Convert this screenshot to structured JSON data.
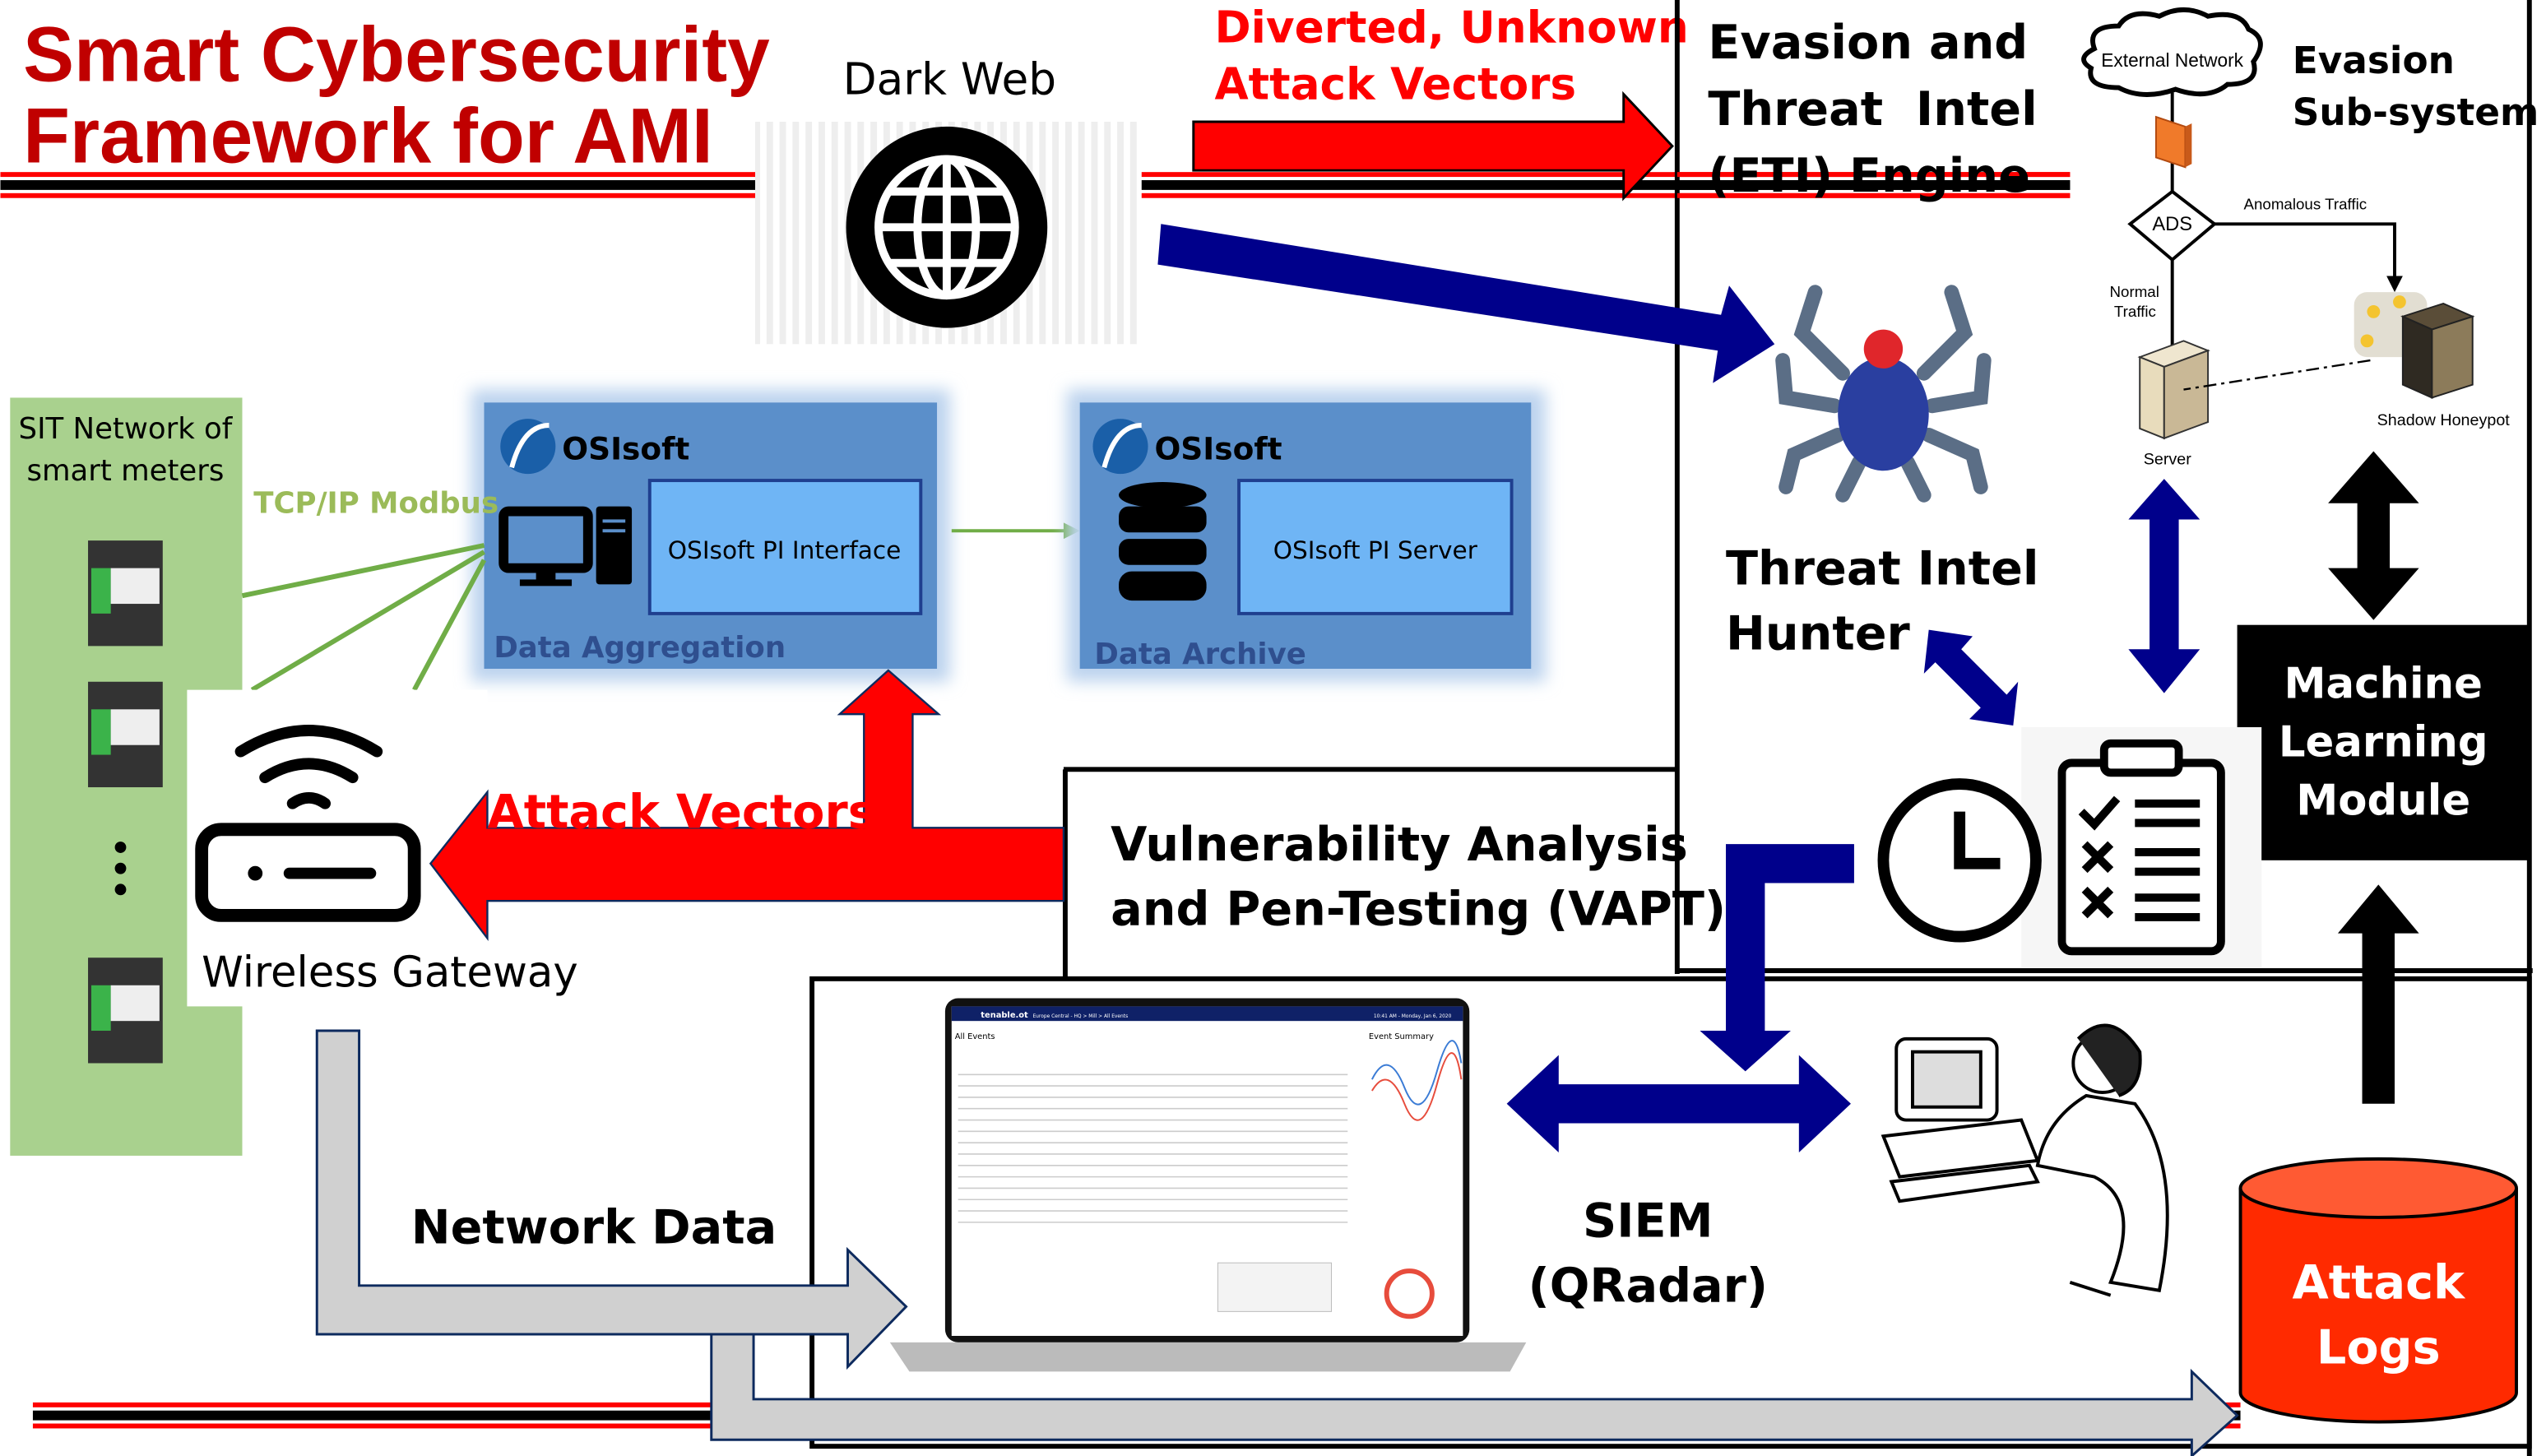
{
  "title": {
    "line1": "Smart Cybersecurity",
    "line2": "Framework for AMI"
  },
  "dark_web": {
    "label": "Dark Web",
    "icon": "globe-icon"
  },
  "diverted": {
    "line1": "Diverted, Unknown",
    "line2": "Attack Vectors"
  },
  "eti": {
    "line1": "Evasion and",
    "line2": "Threat  Intel",
    "line3": "(ETI) Engine"
  },
  "evasion": {
    "title1": "Evasion",
    "title2": "Sub-system",
    "external_network": "External Network",
    "ads": "ADS",
    "anomalous_traffic": "Anomalous Traffic",
    "normal_traffic1": "Normal",
    "normal_traffic2": "Traffic",
    "server": "Server",
    "shadow_honeypot": "Shadow Honeypot"
  },
  "threat_hunter": {
    "line1": "Threat Intel",
    "line2": "Hunter",
    "icon": "spider-icon"
  },
  "ml_module": {
    "line1": "Machine",
    "line2": "Learning",
    "line3": "Module"
  },
  "attack_logs": {
    "line1": "Attack",
    "line2": "Logs"
  },
  "vapt": {
    "line1": "Vulnerability Analysis",
    "line2": "and Pen-Testing (VAPT)"
  },
  "siem": {
    "line1": "SIEM",
    "line2": "(QRadar)"
  },
  "laptop_screen": {
    "brand": "tenable.ot",
    "breadcrumb": "Europe Central - HQ > Mill > All Events",
    "datetime": "10:41 AM - Monday, Jan 6, 2020",
    "page": "All Events",
    "summary": "Event Summary"
  },
  "osisoft": {
    "logo": "OSIsoft",
    "interface": "OSIsoft PI Interface",
    "server": "OSIsoft PI Server",
    "aggregation": "Data Aggregation",
    "archive": "Data Archive"
  },
  "sit": {
    "line1": "SIT Network of",
    "line2": "smart meters"
  },
  "tcp": "TCP/IP Modbus",
  "gateway": "Wireless Gateway",
  "attack_vectors": "Attack Vectors",
  "network_data": "Network Data",
  "colors": {
    "title_red": "#c00000",
    "attack_red": "#ff0000",
    "navy": "#00008b",
    "panel_green": "#a9d18e",
    "osi_blue": "#5b8fca",
    "logs_red": "#ff2a00"
  }
}
